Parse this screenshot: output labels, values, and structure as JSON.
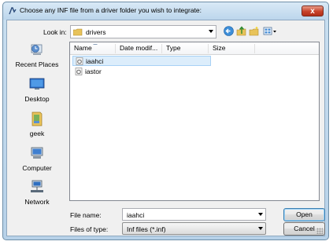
{
  "window": {
    "title": "Choose any INF file from a driver folder you wish to integrate:",
    "close_glyph": "x"
  },
  "lookin": {
    "label": "Look in:",
    "value": "drivers"
  },
  "toolbar": {
    "icons": [
      "back-icon",
      "up-folder-icon",
      "new-folder-icon",
      "view-menu-icon"
    ]
  },
  "places": [
    {
      "label": "Recent Places",
      "icon": "recent-places-icon"
    },
    {
      "label": "Desktop",
      "icon": "desktop-icon"
    },
    {
      "label": "geek",
      "icon": "user-folder-icon"
    },
    {
      "label": "Computer",
      "icon": "computer-icon"
    },
    {
      "label": "Network",
      "icon": "network-icon"
    }
  ],
  "columns": [
    "Name",
    "Date modif...",
    "Type",
    "Size"
  ],
  "files": [
    {
      "name": "iaahci",
      "selected": true
    },
    {
      "name": "iastor",
      "selected": false
    }
  ],
  "filename": {
    "label": "File name:",
    "value": "iaahci"
  },
  "filetype": {
    "label": "Files of type:",
    "value": "Inf files (*.inf)"
  },
  "buttons": {
    "open": "Open",
    "cancel": "Cancel"
  },
  "colors": {
    "selection": "#dcedfb",
    "close_red": "#c8432b",
    "frame": "#b7d1e8"
  }
}
